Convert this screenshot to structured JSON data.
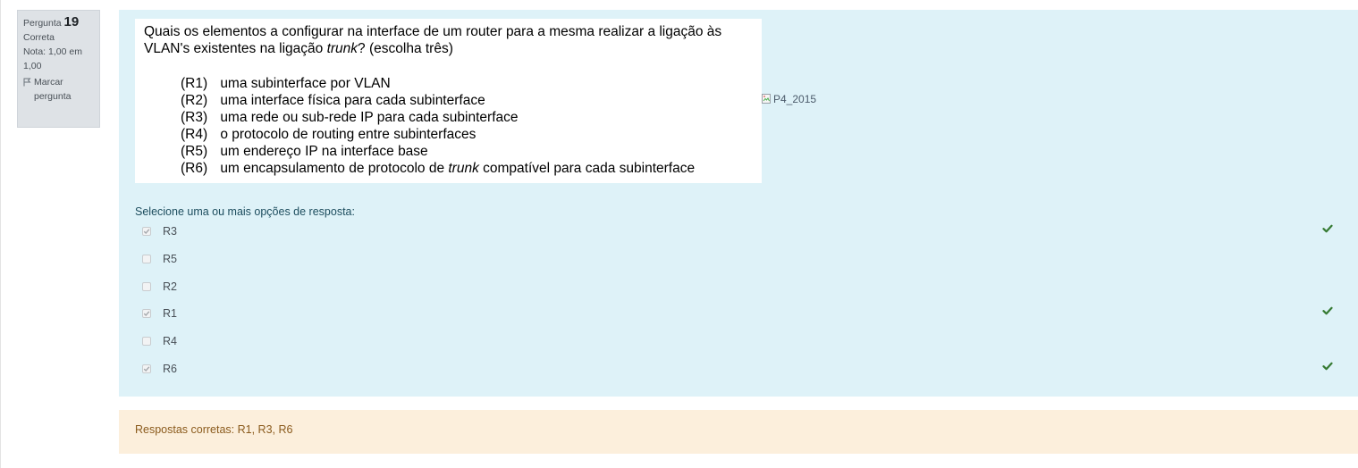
{
  "info": {
    "question_label": "Pergunta",
    "question_number": "19",
    "state": "Correta",
    "grade": "Nota: 1,00 em 1,00",
    "flag_label": "Marcar pergunta",
    "flag_icon": "flag-icon"
  },
  "question": {
    "intro_pre": "Quais os elementos a configurar na interface de um router para a mesma realizar a ligação às VLAN's existentes na ligação ",
    "intro_italic": "trunk",
    "intro_post": "? (escolha três)",
    "options": [
      {
        "code": "(R1)",
        "text": "uma subinterface por VLAN"
      },
      {
        "code": "(R2)",
        "text": "uma interface física para cada subinterface"
      },
      {
        "code": "(R3)",
        "text": "uma rede ou sub-rede IP para cada subinterface"
      },
      {
        "code": "(R4)",
        "text": "o protocolo de routing entre subinterfaces"
      },
      {
        "code": "(R5)",
        "text": "um endereço IP na interface base"
      },
      {
        "code": "(R6)",
        "text": "um encapsulamento de protocolo de ",
        "italic": "trunk",
        "after": " compatível para cada subinterface"
      }
    ],
    "image_alt": "P4_2015",
    "image_icon": "broken-image-icon"
  },
  "answer": {
    "prompt": "Selecione uma ou mais opções de resposta:",
    "choices": [
      {
        "label": "R3",
        "checked": true,
        "correct": true
      },
      {
        "label": "R5",
        "checked": false,
        "correct": false
      },
      {
        "label": "R2",
        "checked": false,
        "correct": false
      },
      {
        "label": "R1",
        "checked": true,
        "correct": true
      },
      {
        "label": "R4",
        "checked": false,
        "correct": false
      },
      {
        "label": "R6",
        "checked": true,
        "correct": true
      }
    ],
    "correct_icon": "check-icon"
  },
  "feedback": {
    "right_answer": "Respostas corretas: R1, R3, R6"
  },
  "colors": {
    "formulation_bg": "#def2f8",
    "outcome_bg": "#fcefdc",
    "info_bg": "#dee2e6",
    "correct_tick": "#357a32"
  }
}
